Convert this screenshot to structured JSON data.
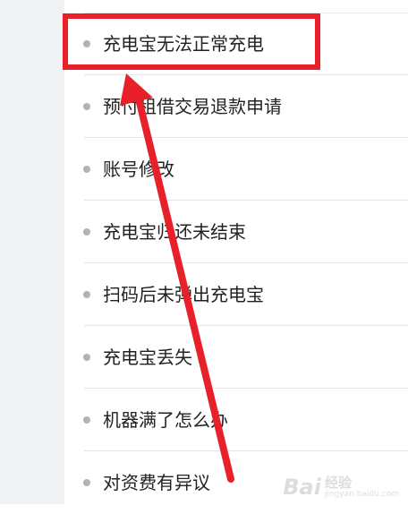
{
  "help_list": {
    "items": [
      {
        "label": "充电宝无法正常充电"
      },
      {
        "label": "预付租借交易退款申请"
      },
      {
        "label": "账号修改"
      },
      {
        "label": "充电宝归还未结束"
      },
      {
        "label": "扫码后未弹出充电宝"
      },
      {
        "label": "充电宝丢失"
      },
      {
        "label": "机器满了怎么办"
      },
      {
        "label": "对资费有异议"
      }
    ]
  },
  "annotation": {
    "highlight_color": "#e8202a",
    "arrow_color": "#e8202a"
  },
  "watermark": {
    "brand": "Bai",
    "brand_cn": "经验",
    "url": "jingyan.baidu.com"
  }
}
